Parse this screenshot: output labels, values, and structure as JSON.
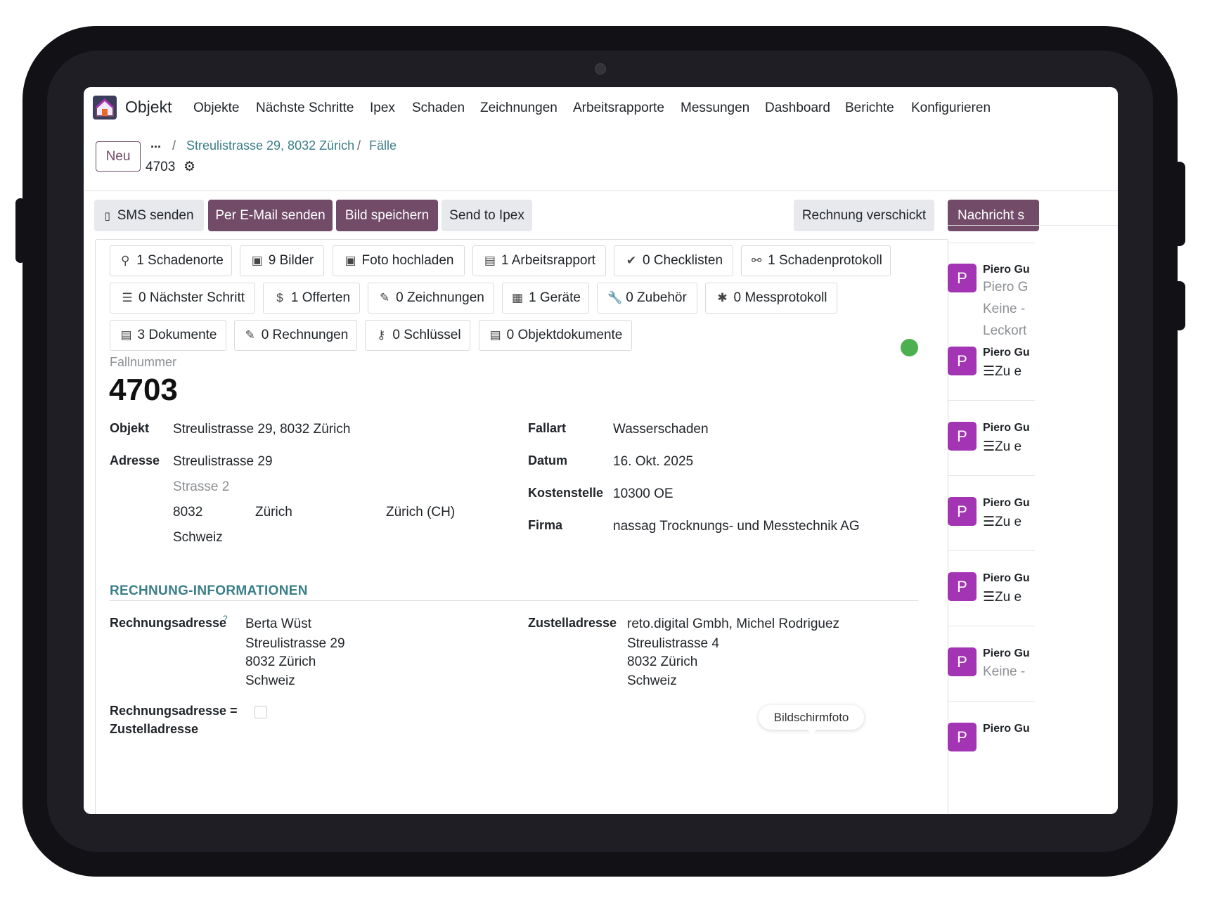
{
  "navbar": {
    "app_title": "Objekt",
    "menu": [
      "Objekte",
      "Nächste Schritte",
      "Ipex",
      "Schaden",
      "Zeichnungen",
      "Arbeitsrapporte",
      "Messungen",
      "Dashboard",
      "Berichte",
      "Konfigurieren"
    ]
  },
  "control": {
    "new_label": "Neu",
    "breadcrumb_ellipsis": "...",
    "breadcrumb": [
      "Streulistrasse 29, 8032 Zürich",
      "Fälle"
    ],
    "record_id": "4703"
  },
  "header_buttons": {
    "sms": "SMS senden",
    "email": "Per E-Mail senden",
    "save_image": "Bild speichern",
    "send_ipex": "Send to Ipex",
    "invoice_sent": "Rechnung verschickt",
    "message": "Nachricht s"
  },
  "smart_buttons": [
    {
      "icon": "map-marker-icon",
      "glyph": "⚲",
      "label": "1 Schadenorte"
    },
    {
      "icon": "image-icon",
      "glyph": "▣",
      "label": "9 Bilder"
    },
    {
      "icon": "image-icon",
      "glyph": "▣",
      "label": "Foto hochladen"
    },
    {
      "icon": "file-icon",
      "glyph": "▤",
      "label": "1 Arbeitsrapport"
    },
    {
      "icon": "check-icon",
      "glyph": "✔",
      "label": "0 Checklisten"
    },
    {
      "icon": "unlink-icon",
      "glyph": "⚯",
      "label": "1 Schadenprotokoll"
    },
    {
      "icon": "tasks-icon",
      "glyph": "☰",
      "label": "0 Nächster Schritt"
    },
    {
      "icon": "dollar-icon",
      "glyph": "$",
      "label": "1 Offerten"
    },
    {
      "icon": "pencil-icon",
      "glyph": "✎",
      "label": "0 Zeichnungen"
    },
    {
      "icon": "building-icon",
      "glyph": "▦",
      "label": "1 Geräte"
    },
    {
      "icon": "wrench-icon",
      "glyph": "🔧",
      "label": "0 Zubehör"
    },
    {
      "icon": "asterisk-icon",
      "glyph": "✱",
      "label": "0 Messprotokoll"
    },
    {
      "icon": "file-icon",
      "glyph": "▤",
      "label": "3 Dokumente"
    },
    {
      "icon": "edit-icon",
      "glyph": "✎",
      "label": "0 Rechnungen"
    },
    {
      "icon": "key-icon",
      "glyph": "⚷",
      "label": "0 Schlüssel"
    },
    {
      "icon": "file-icon",
      "glyph": "▤",
      "label": "0 Objektdokumente"
    }
  ],
  "form": {
    "case_label": "Fallnummer",
    "case_number": "4703",
    "objekt_label": "Objekt",
    "objekt_value": "Streulistrasse 29, 8032 Zürich",
    "adresse_label": "Adresse",
    "street": "Streulistrasse 29",
    "street2_placeholder": "Strasse 2",
    "zip": "8032",
    "city": "Zürich",
    "state": "Zürich (CH)",
    "country": "Schweiz",
    "fallart_label": "Fallart",
    "fallart_value": "Wasserschaden",
    "datum_label": "Datum",
    "datum_value": "16. Okt. 2025",
    "kostenstelle_label": "Kostenstelle",
    "kostenstelle_value": "10300 OE",
    "firma_label": "Firma",
    "firma_value": "nassag Trocknungs- und Messtechnik AG",
    "status_color": "#4caf50"
  },
  "invoice": {
    "section_title": "RECHNUNG-INFORMATIONEN",
    "billing_label": "Rechnungsadresse",
    "billing_help": "?",
    "billing_lines": [
      "Berta Wüst",
      "Streulistrasse 29",
      "8032 Zürich",
      "Schweiz"
    ],
    "delivery_label": "Zustelladresse",
    "delivery_lines": [
      "reto.digital Gmbh, Michel Rodriguez",
      "Streulistrasse 4",
      "8032 Zürich",
      "Schweiz"
    ],
    "same_label_line1": "Rechnungsadresse =",
    "same_label_line2": "Zustelladresse"
  },
  "chatter": [
    {
      "avatar": "P",
      "name": "Piero Gu",
      "lines": [
        {
          "text": "Piero G",
          "muted": true
        },
        {
          "text": "Keine -",
          "muted": true
        },
        {
          "text": "Leckort",
          "muted": true
        }
      ]
    },
    {
      "avatar": "P",
      "name": "Piero Gu",
      "lines": [
        {
          "text": "☰Zu e",
          "muted": false
        }
      ]
    },
    {
      "avatar": "P",
      "name": "Piero Gu",
      "lines": [
        {
          "text": "☰Zu e",
          "muted": false
        }
      ]
    },
    {
      "avatar": "P",
      "name": "Piero Gu",
      "lines": [
        {
          "text": "☰Zu e",
          "muted": false
        }
      ]
    },
    {
      "avatar": "P",
      "name": "Piero Gu",
      "lines": [
        {
          "text": "☰Zu e",
          "muted": false
        }
      ]
    },
    {
      "avatar": "P",
      "name": "Piero Gu",
      "lines": [
        {
          "text": "Keine -",
          "muted": true
        }
      ]
    },
    {
      "avatar": "P",
      "name": "Piero Gu",
      "lines": []
    }
  ],
  "tooltip": "Bildschirmfoto",
  "colors": {
    "brand": "#714B67",
    "link": "#3a7e88",
    "avatar": "#a335b5"
  }
}
